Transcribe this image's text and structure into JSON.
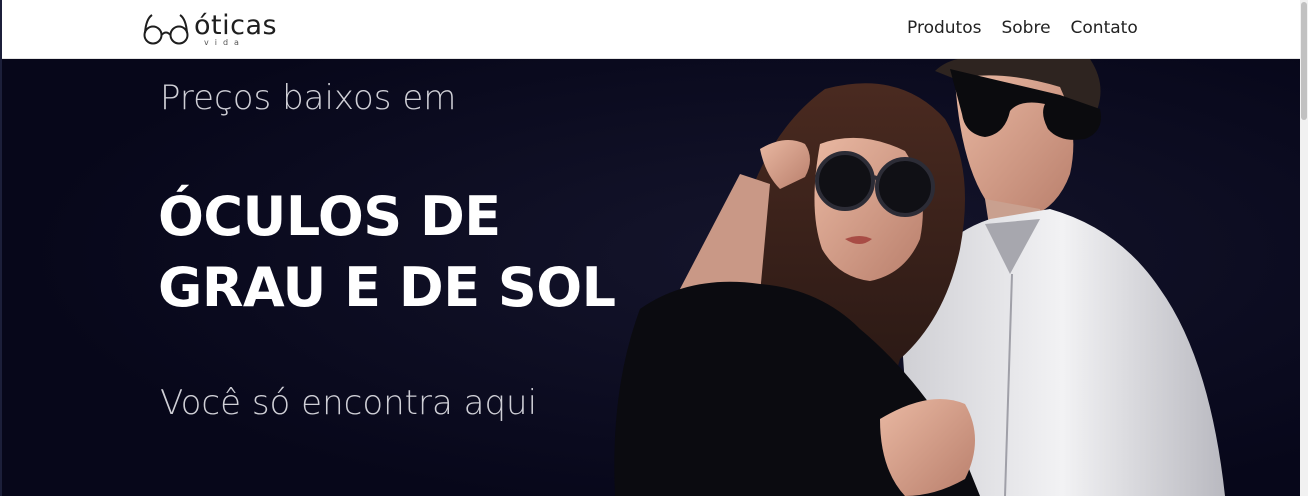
{
  "brand": {
    "name": "óticas",
    "tagline": "vida"
  },
  "nav": {
    "items": [
      "Produtos",
      "Sobre",
      "Contato"
    ]
  },
  "hero": {
    "pretitle": "Preços baixos em",
    "title_line1": "ÓCULOS DE",
    "title_line2": "GRAU E DE SOL",
    "subtitle": "Você só encontra aqui"
  },
  "colors": {
    "hero_background": "#0a0a1c",
    "hero_title": "#ffffff",
    "hero_text": "#cfcfd6",
    "nav_text": "#222222"
  },
  "icons": {
    "logo": "eyeglasses-icon"
  }
}
